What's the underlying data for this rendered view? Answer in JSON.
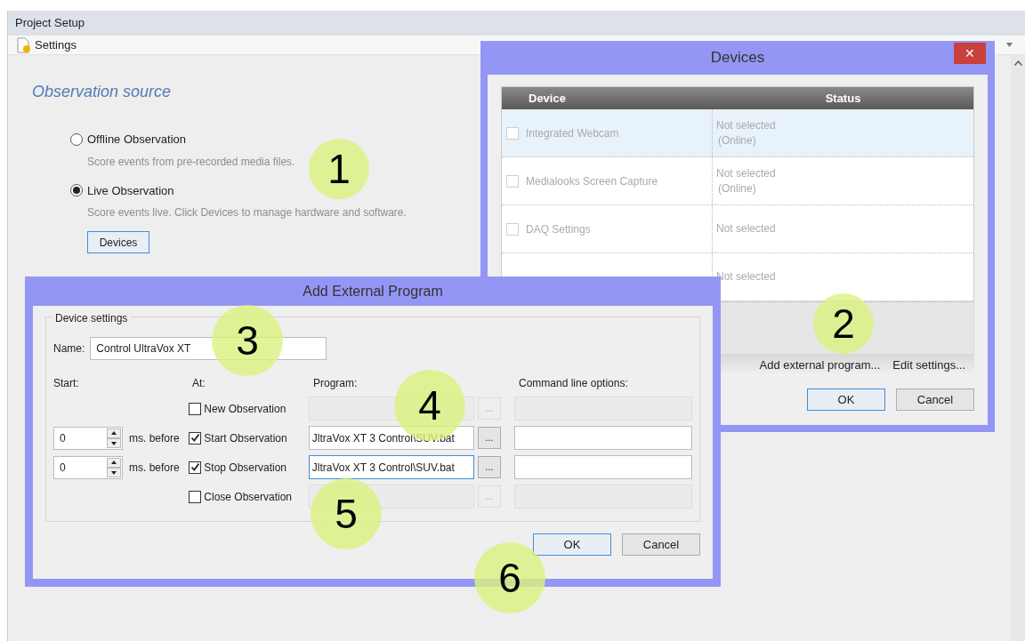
{
  "window": {
    "title": "Project Setup"
  },
  "toolbar": {
    "label": "Settings"
  },
  "observation_source": {
    "heading": "Observation source",
    "options": [
      {
        "label": "Offline Observation",
        "description": "Score events from pre-recorded media files.",
        "selected": false
      },
      {
        "label": "Live Observation",
        "description": "Score events live. Click Devices to manage hardware and software.",
        "selected": true
      }
    ],
    "button": "Devices"
  },
  "devices_dialog": {
    "title": "Devices",
    "close": "✕",
    "columns": [
      "Device",
      "Status"
    ],
    "rows": [
      {
        "name": "Integrated Webcam",
        "status": [
          "Not selected",
          "(Online)"
        ],
        "checked": false,
        "selected": true
      },
      {
        "name": "Medialooks Screen Capture",
        "status": [
          "Not selected",
          "(Online)"
        ],
        "checked": false,
        "selected": false
      },
      {
        "name": "DAQ Settings",
        "status": [
          "Not selected"
        ],
        "checked": false,
        "selected": false
      },
      {
        "status": [
          "Not selected"
        ],
        "selected": false
      }
    ],
    "links": [
      "Add external program...",
      "Edit settings..."
    ],
    "buttons": [
      {
        "label": "OK",
        "default": true
      },
      {
        "label": "Cancel",
        "default": false
      }
    ]
  },
  "add_program_dialog": {
    "title": "Add External Program",
    "group": "Device settings",
    "name_label": "Name:",
    "name_value": "Control UltraVox XT",
    "headers": [
      "Start:",
      "At:",
      "Program:",
      "Command line options:"
    ],
    "rows": [
      {
        "event": "New Observation",
        "checked": false,
        "browse": "..."
      },
      {
        "start": "0",
        "unit": "ms. before",
        "event": "Start Observation",
        "checked": true,
        "program": "JltraVox XT 3 Control\\SUV.bat",
        "browse": "...",
        "focused": false
      },
      {
        "start": "0",
        "unit": "ms. before",
        "event": "Stop Observation",
        "checked": true,
        "program": "JltraVox XT 3 Control\\SUV.bat",
        "browse": "...",
        "focused": true
      },
      {
        "event": "Close Observation",
        "checked": false,
        "browse": "..."
      }
    ],
    "buttons": [
      {
        "label": "OK",
        "default": true
      },
      {
        "label": "Cancel",
        "default": false
      }
    ]
  },
  "callouts": [
    "1",
    "2",
    "3",
    "4",
    "5",
    "6"
  ]
}
